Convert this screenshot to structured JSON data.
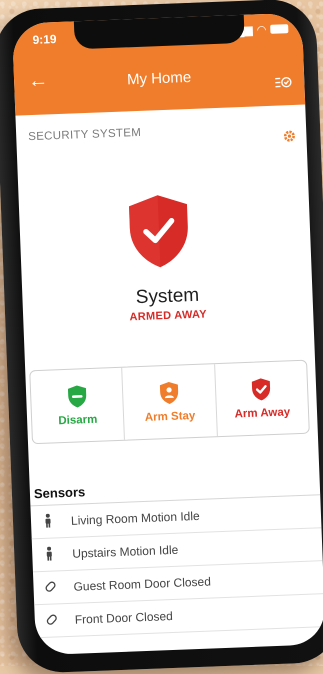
{
  "status_bar": {
    "time": "9:19"
  },
  "header": {
    "title": "My Home"
  },
  "security": {
    "section_title": "SECURITY SYSTEM",
    "system_name": "System",
    "system_status": "ARMED AWAY"
  },
  "actions": [
    {
      "label": "Disarm",
      "color": "#28a845",
      "icon": "minus-shield-icon"
    },
    {
      "label": "Arm Stay",
      "color": "#ef7d2b",
      "icon": "person-shield-icon"
    },
    {
      "label": "Arm Away",
      "color": "#d62b27",
      "icon": "check-shield-icon"
    }
  ],
  "sensors": {
    "title": "Sensors",
    "items": [
      {
        "label": "Living Room Motion Idle",
        "icon": "person-icon"
      },
      {
        "label": "Upstairs Motion Idle",
        "icon": "person-icon"
      },
      {
        "label": "Guest Room Door Closed",
        "icon": "door-icon"
      },
      {
        "label": "Front Door Closed",
        "icon": "door-icon"
      }
    ]
  },
  "colors": {
    "accent": "#ef7d2b",
    "armed": "#d62b27",
    "disarm": "#28a845"
  }
}
